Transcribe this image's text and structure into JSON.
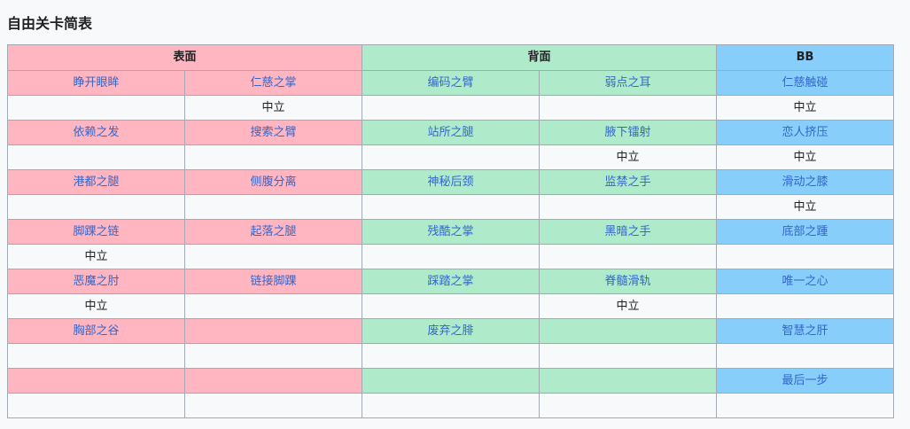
{
  "heading": "自由关卡简表",
  "groups": [
    {
      "label": "表面",
      "color": "pink"
    },
    {
      "label": "背面",
      "color": "green"
    },
    {
      "label": "BB",
      "color": "blue"
    }
  ],
  "rows": [
    {
      "names": [
        "睁开眼眸",
        "仁慈之掌",
        "编码之臂",
        "弱点之耳",
        "仁慈触碰"
      ],
      "notes": [
        "",
        "中立",
        "",
        "",
        "中立"
      ]
    },
    {
      "names": [
        "依赖之发",
        "搜索之臂",
        "站所之腿",
        "腋下镭射",
        "恋人挤压"
      ],
      "notes": [
        "",
        "",
        "",
        "中立",
        "中立"
      ]
    },
    {
      "names": [
        "港都之腿",
        "侧腹分离",
        "神秘后颈",
        "监禁之手",
        "滑动之膝"
      ],
      "notes": [
        "",
        "",
        "",
        "",
        "中立"
      ]
    },
    {
      "names": [
        "脚踝之链",
        "起落之腿",
        "残酷之掌",
        "黑暗之手",
        "底部之踵"
      ],
      "notes": [
        "中立",
        "",
        "",
        "",
        ""
      ]
    },
    {
      "names": [
        "恶魔之肘",
        "链接脚踝",
        "踩踏之掌",
        "脊髓滑轨",
        "唯一之心"
      ],
      "notes": [
        "中立",
        "",
        "",
        "中立",
        ""
      ]
    },
    {
      "names": [
        "胸部之谷",
        "",
        "废弃之腓",
        "",
        "智慧之肝"
      ],
      "notes": [
        "",
        "",
        "",
        "",
        ""
      ]
    },
    {
      "names": [
        "",
        "",
        "",
        "",
        "最后一步"
      ],
      "notes": [
        "",
        "",
        "",
        "",
        ""
      ]
    }
  ]
}
